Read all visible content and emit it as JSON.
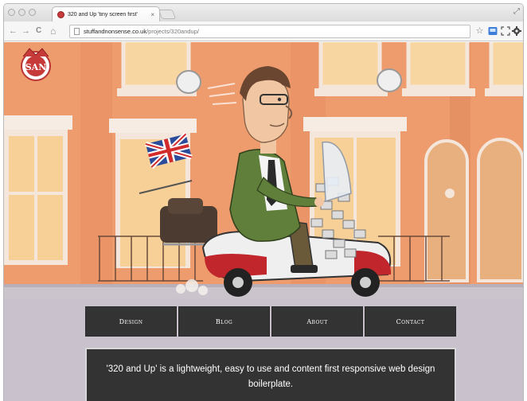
{
  "browser": {
    "tab": {
      "title": "320 and Up 'tiny screen first'",
      "close_glyph": "×"
    },
    "nav": {
      "back": "←",
      "forward": "→",
      "reload": "C",
      "home": "⌂"
    },
    "omnibox": {
      "domain": "stuffandnonsense.co.uk",
      "path": "/projects/320andup/"
    },
    "tools": {
      "star": "☆",
      "settings": "≡"
    }
  },
  "site": {
    "logo_alt": "SAN",
    "nav": [
      {
        "label": "Design"
      },
      {
        "label": "Blog"
      },
      {
        "label": "About"
      },
      {
        "label": "Contact"
      }
    ],
    "intro": "'320 and Up' is a lightweight, easy to use and content first responsive web design boilerplate."
  },
  "colors": {
    "wall": "#f2a06f",
    "window_frame": "#f6e7dc",
    "nav_bg": "#333333",
    "accent_red": "#c63a3a"
  }
}
